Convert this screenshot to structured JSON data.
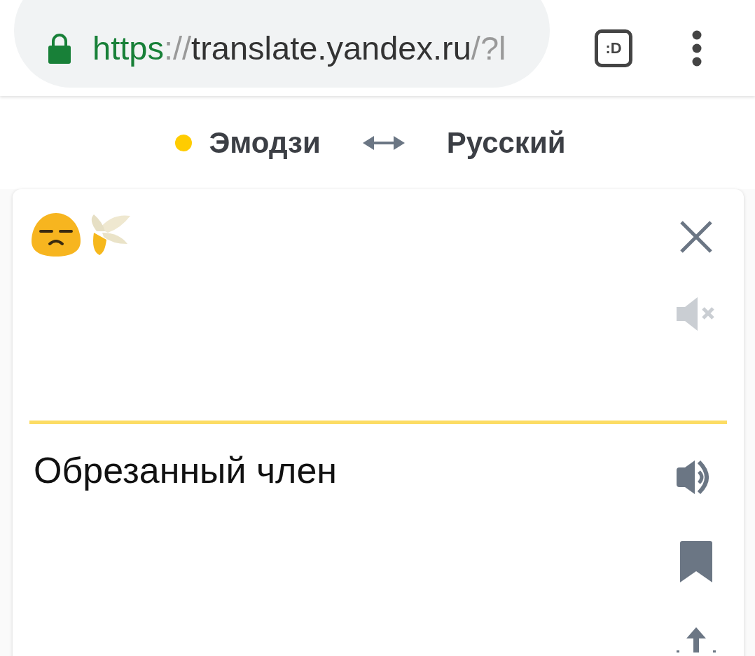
{
  "address_bar": {
    "parts": [
      {
        "text": "https",
        "kind": "scheme"
      },
      {
        "text": "://",
        "kind": "muted"
      },
      {
        "text": "translate.yandex.ru",
        "kind": "host"
      },
      {
        "text": "/?l",
        "kind": "muted"
      }
    ]
  },
  "tab_switcher": {
    "label": ":D"
  },
  "languages": {
    "source": {
      "label": "Эмодзи",
      "detected": true
    },
    "target": {
      "label": "Русский"
    }
  },
  "source": {
    "speaker_disabled": true
  },
  "translation": {
    "text": "Обрезанный член",
    "speaker_disabled": false
  }
}
